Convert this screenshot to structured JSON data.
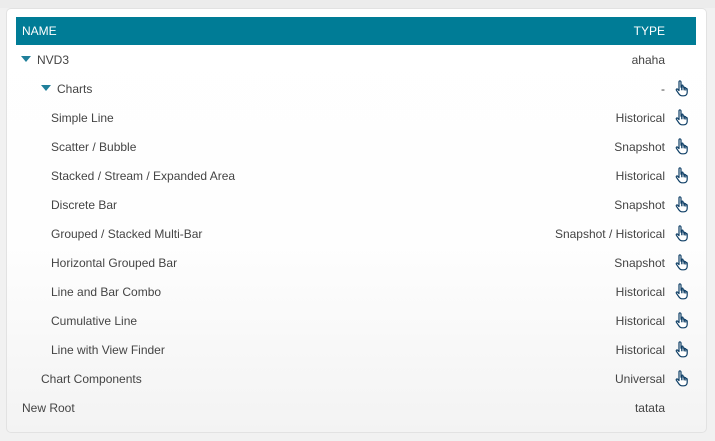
{
  "table": {
    "header": {
      "name": "NAME",
      "type": "TYPE"
    },
    "rows": [
      {
        "label": "NVD3",
        "type": "ahaha",
        "level": 0,
        "expander": true,
        "action": false
      },
      {
        "label": "Charts",
        "type": "-",
        "level": 1,
        "expander": true,
        "action": true
      },
      {
        "label": "Simple Line",
        "type": "Historical",
        "level": 2,
        "expander": false,
        "action": true
      },
      {
        "label": "Scatter / Bubble",
        "type": "Snapshot",
        "level": 2,
        "expander": false,
        "action": true
      },
      {
        "label": "Stacked / Stream / Expanded Area",
        "type": "Historical",
        "level": 2,
        "expander": false,
        "action": true
      },
      {
        "label": "Discrete Bar",
        "type": "Snapshot",
        "level": 2,
        "expander": false,
        "action": true
      },
      {
        "label": "Grouped / Stacked Multi-Bar",
        "type": "Snapshot / Historical",
        "level": 2,
        "expander": false,
        "action": true
      },
      {
        "label": "Horizontal Grouped Bar",
        "type": "Snapshot",
        "level": 2,
        "expander": false,
        "action": true
      },
      {
        "label": "Line and Bar Combo",
        "type": "Historical",
        "level": 2,
        "expander": false,
        "action": true
      },
      {
        "label": "Cumulative Line",
        "type": "Historical",
        "level": 2,
        "expander": false,
        "action": true
      },
      {
        "label": "Line with View Finder",
        "type": "Historical",
        "level": 2,
        "expander": false,
        "action": true
      },
      {
        "label": "Chart Components",
        "type": "Universal",
        "level": 1,
        "expander": false,
        "action": true
      },
      {
        "label": "New Root",
        "type": "tatata",
        "level": 0,
        "expander": false,
        "action": false
      }
    ],
    "action_icon": "pointing-hand-icon",
    "expander_icon": "caret-down-icon"
  },
  "colors": {
    "header_bg": "#007c96",
    "header_text": "#ffffff",
    "expander": "#1f7f9a",
    "icon": "#0f3f66"
  }
}
